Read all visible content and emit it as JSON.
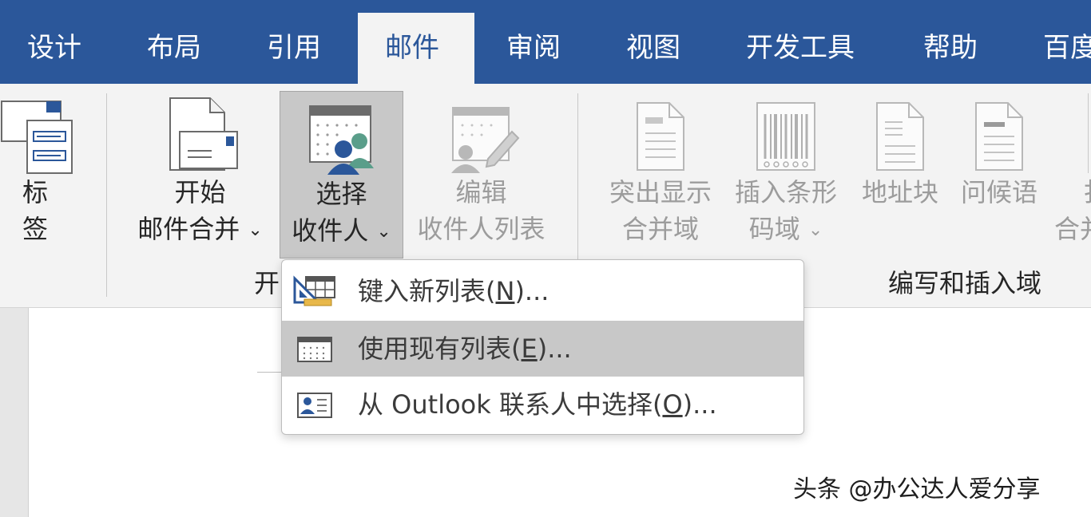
{
  "tabs": [
    "设计",
    "布局",
    "引用",
    "邮件",
    "审阅",
    "视图",
    "开发工具",
    "帮助",
    "百度"
  ],
  "active_tab": "邮件",
  "ribbon": {
    "labels_btn": {
      "line1": "标",
      "line2": "签"
    },
    "start_merge": {
      "line1": "开始",
      "line2": "邮件合并"
    },
    "select_recipients": {
      "line1": "选择",
      "line2": "收件人"
    },
    "edit_list": {
      "line1": "编辑",
      "line2": "收件人列表"
    },
    "highlight_fields": {
      "line1": "突出显示",
      "line2": "合并域"
    },
    "insert_barcode": {
      "line1": "插入条形",
      "line2": "码域"
    },
    "address_block": {
      "line1": "地址块"
    },
    "greeting_line": {
      "line1": "问候语"
    },
    "insert_merge_partial": {
      "line1": "扌",
      "line2": "合并"
    },
    "group_start": "开",
    "group_write_insert": "编写和插入域",
    "chevron": "⌄"
  },
  "menu": {
    "items": [
      {
        "pre": "键入新列表(",
        "key": "N",
        "post": ")..."
      },
      {
        "pre": "使用现有列表(",
        "key": "E",
        "post": ")..."
      },
      {
        "pre": "从 Outlook 联系人中选择(",
        "key": "O",
        "post": ")..."
      }
    ],
    "highlighted_index": 1
  },
  "watermark": "头条 @办公达人爱分享",
  "colors": {
    "tab_bar": "#2b579a",
    "ribbon": "#f3f3f3",
    "pressed": "#c8c8c8"
  }
}
